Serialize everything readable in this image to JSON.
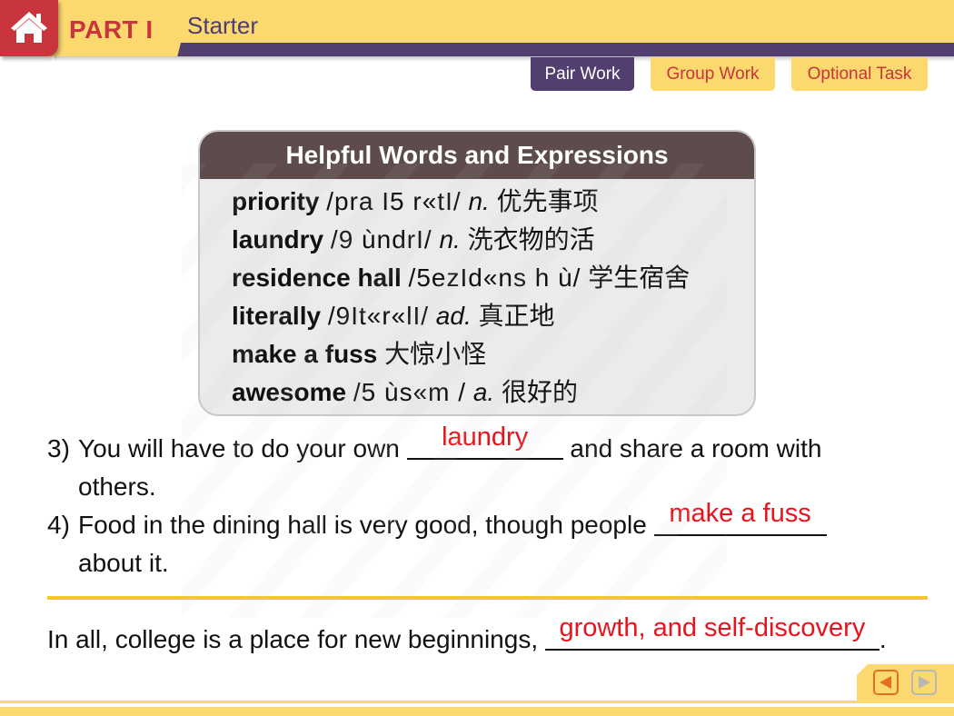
{
  "header": {
    "part_label": "PART I",
    "section_label": "Starter",
    "home_icon": "home-icon"
  },
  "tabs": [
    {
      "label": "Pair Work",
      "active": true
    },
    {
      "label": "Group Work",
      "active": false
    },
    {
      "label": "Optional Task",
      "active": false
    }
  ],
  "vocab": {
    "title": "Helpful Words and Expressions",
    "items": [
      {
        "word": "priority",
        "phonetic": "/pra I5 r«tI/",
        "pos": "n.",
        "meaning": "优先事项"
      },
      {
        "word": "laundry",
        "phonetic": "/9  ùndrI/",
        "pos": "n.",
        "meaning": "洗衣物的活"
      },
      {
        "word": "residence hall",
        "phonetic": "/5ezId«ns h  ù/",
        "pos": "",
        "meaning": "学生宿舍"
      },
      {
        "word": "literally",
        "phonetic": "/9It«r«lI/",
        "pos": "ad.",
        "meaning": "真正地"
      },
      {
        "word": "make a fuss",
        "phonetic": "",
        "pos": "",
        "meaning": "大惊小怪"
      },
      {
        "word": "awesome",
        "phonetic": "/5 ùs«m /",
        "pos": "a.",
        "meaning": "很好的"
      }
    ]
  },
  "exercises": [
    {
      "number": "3)",
      "before": "You will have to do your own ",
      "answer": "laundry",
      "after": " and share a room with",
      "continuation": "others."
    },
    {
      "number": "4)",
      "before": "Food in the dining hall is very good, though people ",
      "answer": "make a fuss",
      "after": "",
      "continuation": "about it."
    }
  ],
  "summary": {
    "before": "In all, college is a place for new beginnings, ",
    "answer": "growth, and self-discovery",
    "after": "."
  },
  "nav": {
    "prev_icon": "previous-arrow-icon",
    "next_icon": "next-arrow-icon"
  },
  "colors": {
    "header_yellow": "#fcd96f",
    "header_purple": "#533f6f",
    "accent_red": "#c8353c",
    "answer_red": "#e8141d",
    "vocab_title_bg": "#5d4c4b",
    "divider_gold": "#f6c628"
  }
}
